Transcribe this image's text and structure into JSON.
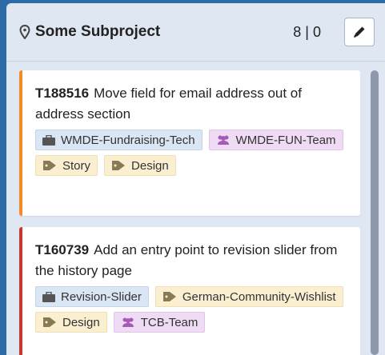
{
  "column": {
    "title": "Some Subproject",
    "counts": "8 | 0",
    "icons": {
      "location": "map-pin-icon",
      "edit": "pencil-icon"
    }
  },
  "cards": [
    {
      "id": "T188516",
      "title": "Move field for email address out of address section",
      "accent": "#f28c28",
      "tags": [
        {
          "label": "WMDE-Fundraising-Tech",
          "kind": "project",
          "icon": "briefcase-icon"
        },
        {
          "label": "WMDE-FUN-Team",
          "kind": "team",
          "icon": "group-icon"
        },
        {
          "label": "Story",
          "kind": "type",
          "icon": "tag-icon"
        },
        {
          "label": "Design",
          "kind": "type",
          "icon": "tag-icon"
        }
      ]
    },
    {
      "id": "T160739",
      "title": "Add an entry point to revision slider from the history page",
      "accent": "#c0392b",
      "tags": [
        {
          "label": "Revision-Slider",
          "kind": "project",
          "icon": "briefcase-icon"
        },
        {
          "label": "German-Community-Wishlist",
          "kind": "type",
          "icon": "tag-icon"
        },
        {
          "label": "Design",
          "kind": "type",
          "icon": "tag-icon"
        },
        {
          "label": "TCB-Team",
          "kind": "team",
          "icon": "group-icon"
        }
      ]
    }
  ],
  "colors": {
    "board_background": "#2d6ba8",
    "column_background": "#dfe7f3",
    "project_tag": "#dbe6f5",
    "team_tag": "#efdcf4",
    "type_tag": "#fbefd2"
  }
}
